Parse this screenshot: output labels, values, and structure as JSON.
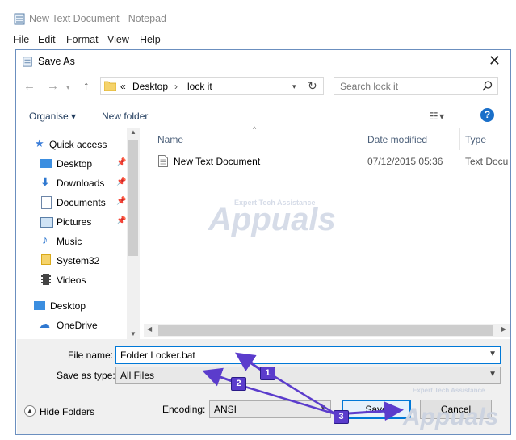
{
  "notepad": {
    "title": "New Text Document - Notepad",
    "menu": [
      "File",
      "Edit",
      "Format",
      "View",
      "Help"
    ]
  },
  "dialog": {
    "title": "Save As",
    "address": {
      "prefix": "«",
      "crumbs": [
        "Desktop",
        "lock it"
      ]
    },
    "search_placeholder": "Search lock it",
    "toolbar": {
      "organise": "Organise ▾",
      "new_folder": "New folder"
    },
    "nav": {
      "items": [
        {
          "label": "Quick access",
          "icon": "star-icon",
          "pinned": false
        },
        {
          "label": "Desktop",
          "icon": "desktop-icon",
          "pinned": true
        },
        {
          "label": "Downloads",
          "icon": "download-icon",
          "pinned": true
        },
        {
          "label": "Documents",
          "icon": "documents-icon",
          "pinned": true
        },
        {
          "label": "Pictures",
          "icon": "pictures-icon",
          "pinned": true
        },
        {
          "label": "Music",
          "icon": "music-icon",
          "pinned": false
        },
        {
          "label": "System32",
          "icon": "folder-icon",
          "pinned": false
        },
        {
          "label": "Videos",
          "icon": "videos-icon",
          "pinned": false
        },
        {
          "label": "Desktop",
          "icon": "desktop-icon",
          "pinned": false
        },
        {
          "label": "OneDrive",
          "icon": "cloud-icon",
          "pinned": false
        }
      ]
    },
    "columns": [
      "Name",
      "Date modified",
      "Type"
    ],
    "files": [
      {
        "name": "New Text Document",
        "date": "07/12/2015 05:36",
        "type": "Text Docu"
      }
    ],
    "form": {
      "file_name_label": "File name:",
      "file_name_value": "Folder Locker.bat",
      "save_type_label": "Save as type:",
      "save_type_value": "All Files",
      "encoding_label": "Encoding:",
      "encoding_value": "ANSI",
      "hide_folders": "Hide Folders",
      "save": "Save",
      "cancel": "Cancel"
    }
  },
  "annotations": [
    "1",
    "2",
    "3"
  ],
  "watermark": {
    "name": "Appuals",
    "tagline": "Expert Tech Assistance"
  },
  "colors": {
    "accent": "#0078d7",
    "annotation": "#5b3ccc",
    "folder": "#f5d36b"
  }
}
